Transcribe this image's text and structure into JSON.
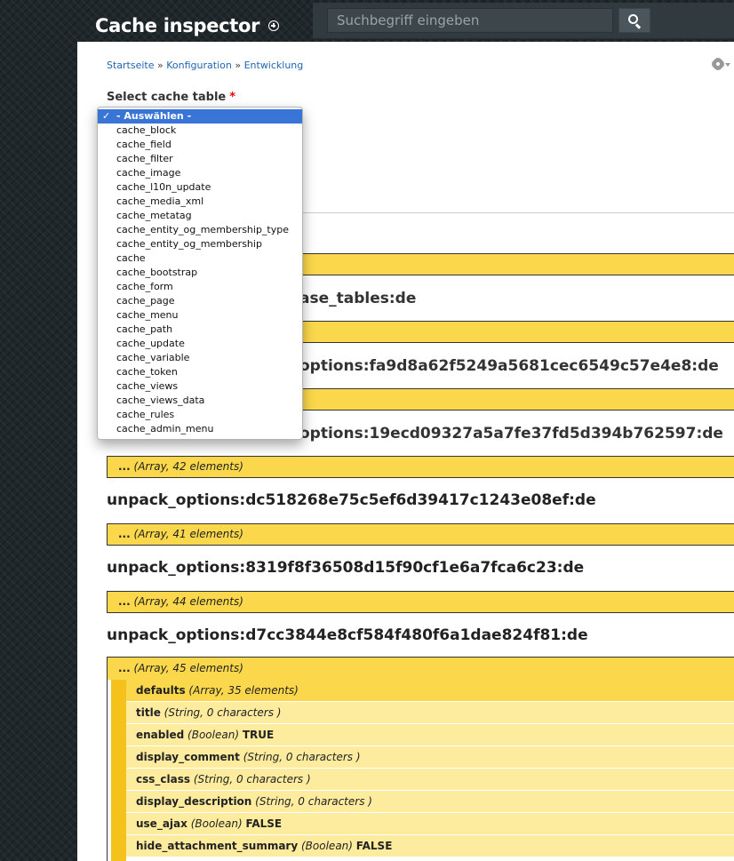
{
  "header": {
    "title": "Cache inspector",
    "search_placeholder": "Suchbegriff eingeben"
  },
  "breadcrumb": [
    "Startseite",
    "Konfiguration",
    "Entwicklung"
  ],
  "breadcrumb_sep": "»",
  "form": {
    "select_label": "Select cache table",
    "required_mark": "*",
    "options": [
      "- Auswählen -",
      "cache_block",
      "cache_field",
      "cache_filter",
      "cache_image",
      "cache_l10n_update",
      "cache_media_xml",
      "cache_metatag",
      "cache_entity_og_membership_type",
      "cache_entity_og_membership",
      "cache",
      "cache_bootstrap",
      "cache_form",
      "cache_page",
      "cache_menu",
      "cache_path",
      "cache_update",
      "cache_variable",
      "cache_token",
      "cache_views",
      "cache_views_data",
      "cache_rules",
      "cache_admin_menu"
    ],
    "selected_option": "- Auswählen -"
  },
  "partial_text": {
    "t1": "ase_tables:de",
    "t2": "options:fa9d8a62f5249a5681cec6549c57e4e8:de",
    "t3": "options:19ecd09327a5a7fe37fd5d394b762597:de"
  },
  "entries": [
    {
      "title": "unpack_options:19ecd09327a5a7fe37fd5d394b762597:de",
      "dots": "...",
      "meta": "(Array, 42 elements)"
    },
    {
      "title": "unpack_options:dc518268e75c5ef6d39417c1243e08ef:de",
      "dots": "...",
      "meta": "(Array, 41 elements)"
    },
    {
      "title": "unpack_options:8319f8f36508d15f90cf1e6a7fca6c23:de",
      "dots": "...",
      "meta": "(Array, 44 elements)"
    },
    {
      "title": "unpack_options:d7cc3844e8cf584f480f6a1dae824f81:de",
      "dots": "...",
      "meta": "(Array, 45 elements)"
    }
  ],
  "expanded_children": [
    {
      "key": "defaults",
      "meta": "(Array, 35 elements)",
      "value": ""
    },
    {
      "key": "title",
      "meta": "(String, 0 characters )",
      "value": ""
    },
    {
      "key": "enabled",
      "meta": "(Boolean)",
      "value": "TRUE"
    },
    {
      "key": "display_comment",
      "meta": "(String, 0 characters )",
      "value": ""
    },
    {
      "key": "css_class",
      "meta": "(String, 0 characters )",
      "value": ""
    },
    {
      "key": "display_description",
      "meta": "(String, 0 characters )",
      "value": ""
    },
    {
      "key": "use_ajax",
      "meta": "(Boolean)",
      "value": "FALSE"
    },
    {
      "key": "hide_attachment_summary",
      "meta": "(Boolean)",
      "value": "FALSE"
    }
  ],
  "colors": {
    "krumo_bar": "#fbd84b",
    "krumo_child_light": "#fdeb9e",
    "accent_link": "#2265b3",
    "select_highlight": "#3875d7"
  }
}
